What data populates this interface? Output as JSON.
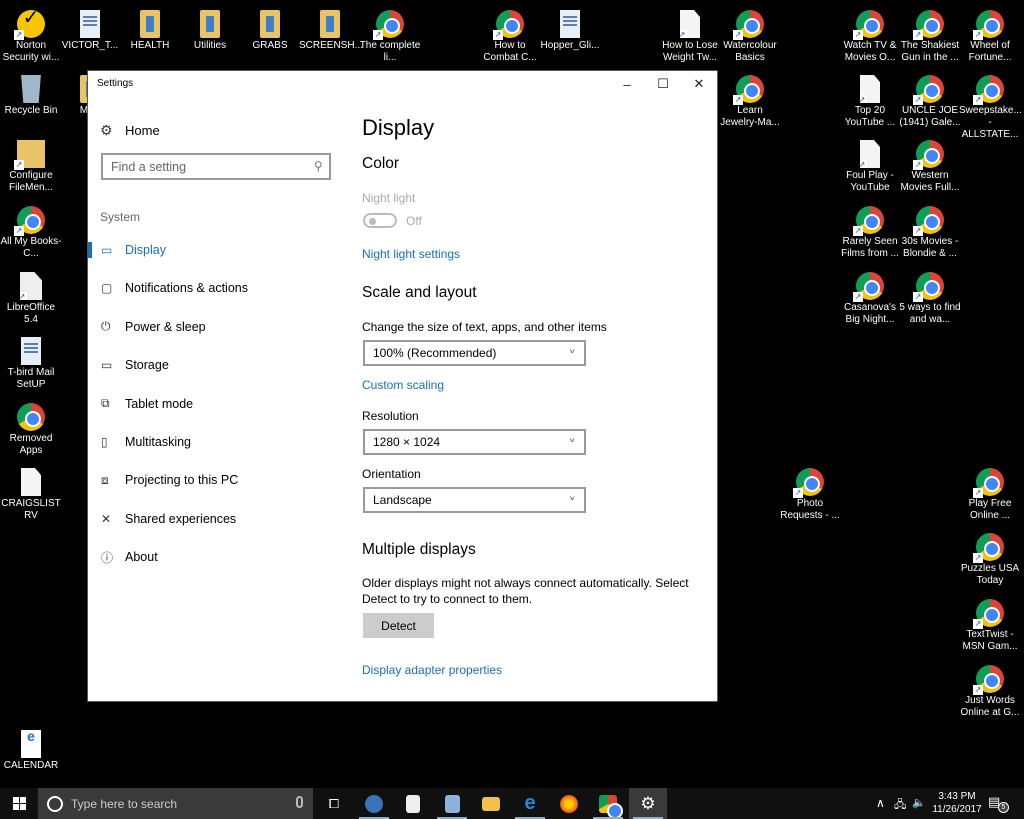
{
  "desktop": {
    "icons": [
      {
        "label": "Norton Security wi...",
        "type": "norton"
      },
      {
        "label": "VICTOR_T...",
        "type": "doc2"
      },
      {
        "label": "HEALTH",
        "type": "folder"
      },
      {
        "label": "Utilities",
        "type": "folder"
      },
      {
        "label": "GRABS",
        "type": "folder"
      },
      {
        "label": "SCREENSH...",
        "type": "folder"
      },
      {
        "label": "The complete li...",
        "type": "chrome"
      },
      {
        "label": "How to Combat C...",
        "type": "chrome"
      },
      {
        "label": "Hopper_Gli...",
        "type": "doc2"
      },
      {
        "label": "How to Lose Weight Tw...",
        "type": "doc"
      },
      {
        "label": "Watercolour Basics",
        "type": "chrome"
      },
      {
        "label": "Watch TV & Movies O...",
        "type": "chrome"
      },
      {
        "label": "The Shakiest Gun in the ...",
        "type": "chrome"
      },
      {
        "label": "Wheel of Fortune...",
        "type": "chrome"
      },
      {
        "label": "Recycle Bin",
        "type": "recycle"
      },
      {
        "label": "MyN",
        "type": "folder"
      },
      {
        "label": "Learn Jewelry-Ma...",
        "type": "chrome"
      },
      {
        "label": "Top 20 YouTube ...",
        "type": "doc"
      },
      {
        "label": "UNCLE JOE (1941) Gale...",
        "type": "chrome"
      },
      {
        "label": "Sweepstake... - ALLSTATE...",
        "type": "chrome"
      },
      {
        "label": "Configure FileMen...",
        "type": "config"
      },
      {
        "label": "Foul Play - YouTube",
        "type": "doc"
      },
      {
        "label": "Western Movies Full...",
        "type": "chrome"
      },
      {
        "label": "All My Books- C...",
        "type": "chrome"
      },
      {
        "label": "Rarely Seen Films from ...",
        "type": "chrome"
      },
      {
        "label": "30s Movies - Blondie & ...",
        "type": "chrome"
      },
      {
        "label": "LibreOffice 5.4",
        "type": "libre"
      },
      {
        "label": "Casanova's Big Night...",
        "type": "chrome"
      },
      {
        "label": "5 ways to find and wa...",
        "type": "chrome"
      },
      {
        "label": "T-bird Mail SetUP",
        "type": "doc2"
      },
      {
        "label": "Removed Apps",
        "type": "chrome-plain"
      },
      {
        "label": "CRAIGSLIST RV",
        "type": "doc-plain"
      },
      {
        "label": "Photo Requests - ...",
        "type": "chrome"
      },
      {
        "label": "Play Free Online ...",
        "type": "chrome"
      },
      {
        "label": "Puzzles USA Today",
        "type": "chrome"
      },
      {
        "label": "TextTwist - MSN Gam...",
        "type": "chrome"
      },
      {
        "label": "Just Words Online at G...",
        "type": "chrome"
      },
      {
        "label": "CALENDAR",
        "type": "pdf"
      }
    ]
  },
  "window": {
    "title": "Settings",
    "minimize": "–",
    "maximize": "☐",
    "close": "✕"
  },
  "nav": {
    "home": "Home",
    "search_placeholder": "Find a setting",
    "section": "System",
    "items": [
      {
        "label": "Display",
        "icon": "display-icon",
        "glyph": "▭",
        "active": true
      },
      {
        "label": "Notifications & actions",
        "icon": "notifications-icon",
        "glyph": "▢"
      },
      {
        "label": "Power & sleep",
        "icon": "power-icon",
        "glyph": "⏻"
      },
      {
        "label": "Storage",
        "icon": "storage-icon",
        "glyph": "▭"
      },
      {
        "label": "Tablet mode",
        "icon": "tablet-mode-icon",
        "glyph": "⧉"
      },
      {
        "label": "Multitasking",
        "icon": "multitasking-icon",
        "glyph": "▯"
      },
      {
        "label": "Projecting to this PC",
        "icon": "projecting-icon",
        "glyph": "⧈"
      },
      {
        "label": "Shared experiences",
        "icon": "shared-experiences-icon",
        "glyph": "✕"
      },
      {
        "label": "About",
        "icon": "about-icon",
        "glyph": "ⓘ"
      }
    ]
  },
  "content": {
    "title": "Display",
    "color_heading": "Color",
    "night_light_label": "Night light",
    "night_light_state": "Off",
    "night_light_settings": "Night light settings",
    "scale_heading": "Scale and layout",
    "scale_label": "Change the size of text, apps, and other items",
    "scale_value": "100% (Recommended)",
    "custom_scaling": "Custom scaling",
    "resolution_label": "Resolution",
    "resolution_value": "1280 × 1024",
    "orientation_label": "Orientation",
    "orientation_value": "Landscape",
    "multiple_heading": "Multiple displays",
    "multiple_text": "Older displays might not always connect automatically. Select Detect to try to connect to them.",
    "detect_button": "Detect",
    "adapter_link": "Display adapter properties"
  },
  "taskbar": {
    "search_placeholder": "Type here to search",
    "apps": [
      "Thunderbird",
      "LibreOffice",
      "Document",
      "File Explorer",
      "Microsoft Edge",
      "Firefox",
      "Google Chrome",
      "Settings"
    ],
    "time": "3:43 PM",
    "date": "11/26/2017",
    "notification_count": "5"
  }
}
